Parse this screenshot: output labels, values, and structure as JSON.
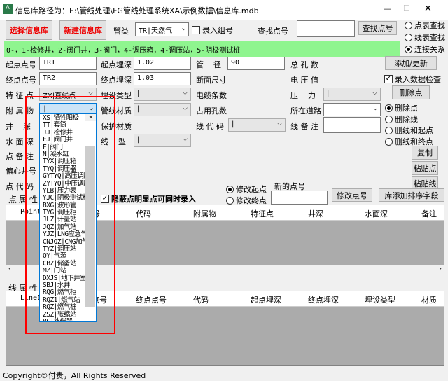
{
  "window": {
    "title": "信息库路径为：E:\\管线处理\\FG管线处理系统XA\\示例数据\\信息库.mdb",
    "minimize": "—",
    "maximize": "☐",
    "close": "✕"
  },
  "toolbar": {
    "select_db": "选择信息库",
    "new_db": "新建信息库",
    "pipe_type_label": "管类",
    "pipe_type_value": "TR|天然气",
    "group_checkbox": "录入组号",
    "find_label": "查找点号",
    "find_value": "",
    "find_button": "查找点号"
  },
  "search_mode": {
    "options": [
      "点表查找",
      "线表查找",
      "连接关系"
    ],
    "selected": 2
  },
  "legend_bar": "0-，1-检修井，2-阀门井，3-阀门，4-调压箱，4-调压站，5-阴极测试桩",
  "fields": {
    "start_point_label": "起点点号",
    "start_point": "TR1",
    "start_depth_label": "起点埋深",
    "start_depth": "1.02",
    "diameter_label": "管    径",
    "diameter": "90",
    "total_holes_label": "总 孔 数",
    "end_point_label": "终点点号",
    "end_point": "TR2",
    "end_depth_label": "终点埋深",
    "end_depth": "1.03",
    "section_label": "断面尺寸",
    "voltage_label": "电 压 值",
    "feature_label": "特 征 点",
    "feature": "ZX|直线点",
    "bury_type_label": "埋设类型",
    "bury_type": "|",
    "cable_count_label": "电缆条数",
    "pressure_label": "压    力",
    "pressure": "|",
    "attachment_label": "附 属 物",
    "attachment": "|",
    "material_label": "管线材质",
    "material": "|",
    "occupied_label": "占用孔数",
    "road_label": "所在道路",
    "road": "",
    "well_depth_label": "井    深",
    "protect_label": "保护材质",
    "line_code_label": "线 代 码",
    "line_code": "|",
    "line_note_label": "线 备 注",
    "line_note": "",
    "water_depth_label": "水 面 深",
    "line_type_label": "线    型",
    "line_type": "|",
    "point_note_label": "点 备 注",
    "offset_well_label": "偏心井号",
    "point_code_label": "点 代 码"
  },
  "right_panel": {
    "add_update": "添加/更新",
    "check_label": "录入数据检查",
    "check_checked": true,
    "delete_point": "删除点",
    "delete_options": [
      "删除点",
      "删除线",
      "删线和起点",
      "删线和终点"
    ],
    "delete_selected": 0,
    "copy": "复制",
    "paste_point": "粘贴点",
    "paste_line": "粘贴线"
  },
  "modify": {
    "options": [
      "修改起点",
      "修改终点"
    ],
    "selected": 0,
    "new_point_label": "新的点号",
    "new_point": "",
    "modify_button": "修改点号",
    "sort_button": "库添加排序字段",
    "hide_checkbox": "隐蔽点明显点可同时录入"
  },
  "attachment_list": [
    "XS|牺牲阳极",
    "TT|套筒",
    "JJ|检修井",
    "FJ|阀门井",
    "F|阀门",
    "N|凝水缸",
    "TYX|调压箱",
    "TYQ|调压器",
    "GYTYQ|高压调压",
    "ZYTYQ|中压调压",
    "YLB|压力表",
    "YJC|阴极测试桩",
    "BXG|波形管",
    "TYG|调压柜",
    "JLZ|计量站",
    "JQZ|加气站",
    "YJZ|LNG应急气",
    "CNJQZ|CNG加气",
    "TYZ|调压站",
    "QY|气源",
    "CBZ|储备站",
    "MZ|门站",
    "DXJS|地下井室",
    "SBJ|水井",
    "RQG|燃气柜",
    "RQZ1|燃气站",
    "RQZ|燃气桩",
    "ZSZ|张缩站",
    "BC|补偿器",
    ""
  ],
  "point_table": {
    "title": "点属性表",
    "columns": [
      "PointID",
      "点号",
      "代码",
      "附属物",
      "特征点",
      "井深",
      "水面深",
      "备注"
    ]
  },
  "line_table": {
    "title": "线属性表",
    "columns": [
      "LineID",
      "起点点号",
      "终点点号",
      "代码",
      "起点埋深",
      "终点埋深",
      "埋设类型",
      "材质"
    ]
  },
  "footer": "Copyright©付贵，All Rights Reserved"
}
